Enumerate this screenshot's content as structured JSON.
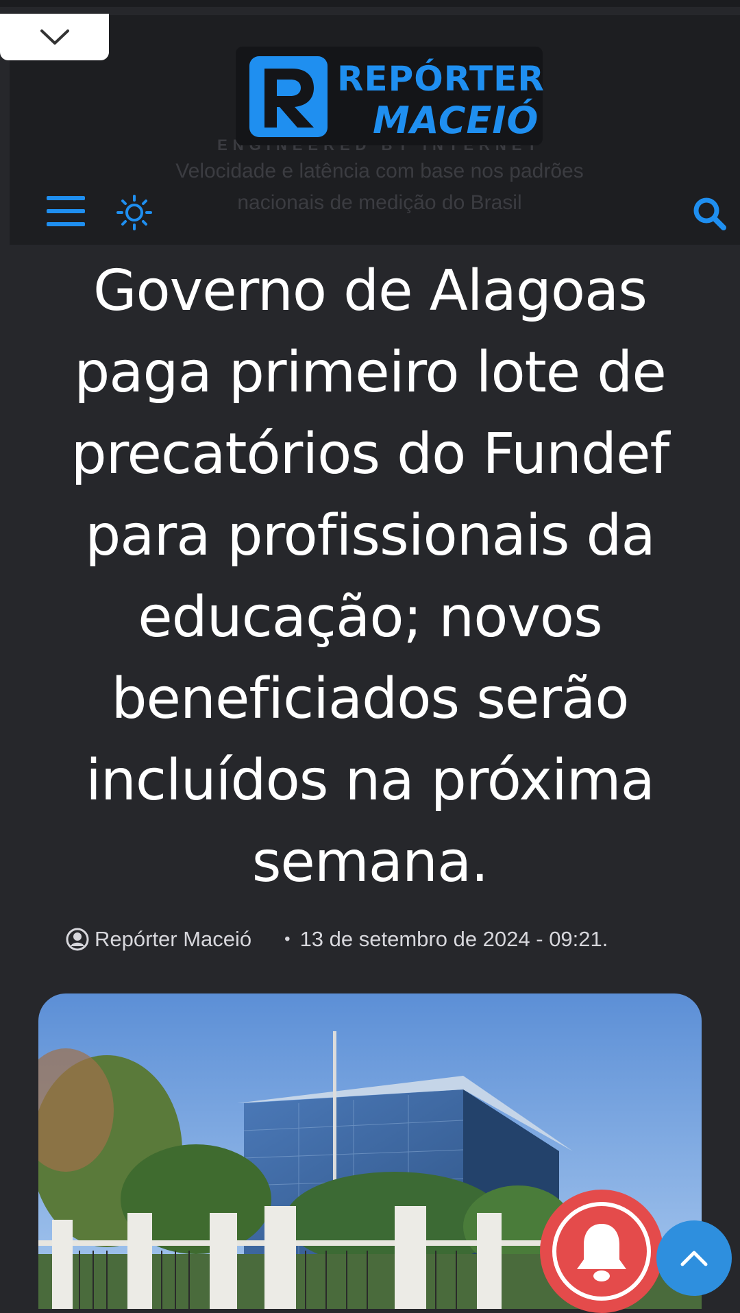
{
  "header": {
    "logo_line1": "REPÓRTER",
    "logo_line2": "MACEIÓ",
    "ad_line1": "ENGINEERED BY INTERNET",
    "ad_line2": "Velocidade e latência com base nos padrões",
    "ad_line3": "nacionais de medição do Brasil",
    "icons": {
      "collapse": "chevron-down-icon",
      "menu": "hamburger-menu-icon",
      "theme": "sun-icon",
      "search": "search-icon"
    },
    "accent_color": "#1f8ff0"
  },
  "article": {
    "title": "Governo de Alagoas paga primeiro lote de precatórios do Fundef para profissionais da educação; novos beneficiados serão incluídos na próxima semana.",
    "author": "Repórter Maceió",
    "date": "13 de setembro de 2024 - 09:21.",
    "separator": "•"
  },
  "floating": {
    "bell_icon": "bell-icon",
    "bell_color": "#e44b4b",
    "scroll_top_icon": "chevron-up-icon",
    "scroll_top_color": "#2e8fde"
  },
  "colors": {
    "page_bg": "#26272b",
    "header_bg": "#1d1e21"
  }
}
